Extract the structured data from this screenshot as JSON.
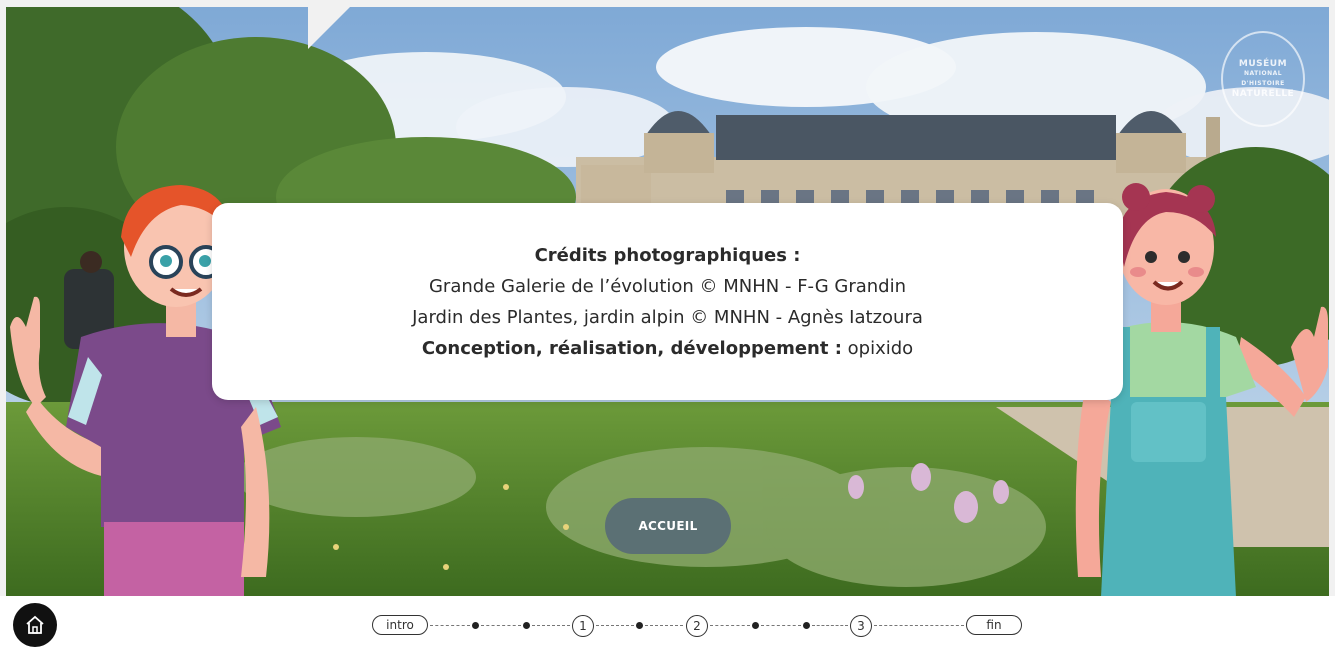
{
  "logo": {
    "line1": "MUSÉUM",
    "line2": "NATIONAL",
    "line3": "D'HISTOIRE",
    "line4": "NATURELLE"
  },
  "credits": {
    "title": "Crédits photographiques :",
    "line1": "Grande Galerie de l’évolution © MNHN - F-G Grandin",
    "line2": "Jardin des Plantes, jardin alpin © MNHN - Agnès Iatzoura",
    "line3_bold": "Conception, réalisation, développement :",
    "line3_value": " opixido"
  },
  "buttons": {
    "accueil": "ACCUEIL"
  },
  "progress": {
    "intro": "intro",
    "step1": "1",
    "step2": "2",
    "step3": "3",
    "fin": "fin"
  },
  "icons": {
    "home": "home-icon"
  },
  "colors": {
    "accent": "#5b7074",
    "panel": "#ffffff"
  }
}
